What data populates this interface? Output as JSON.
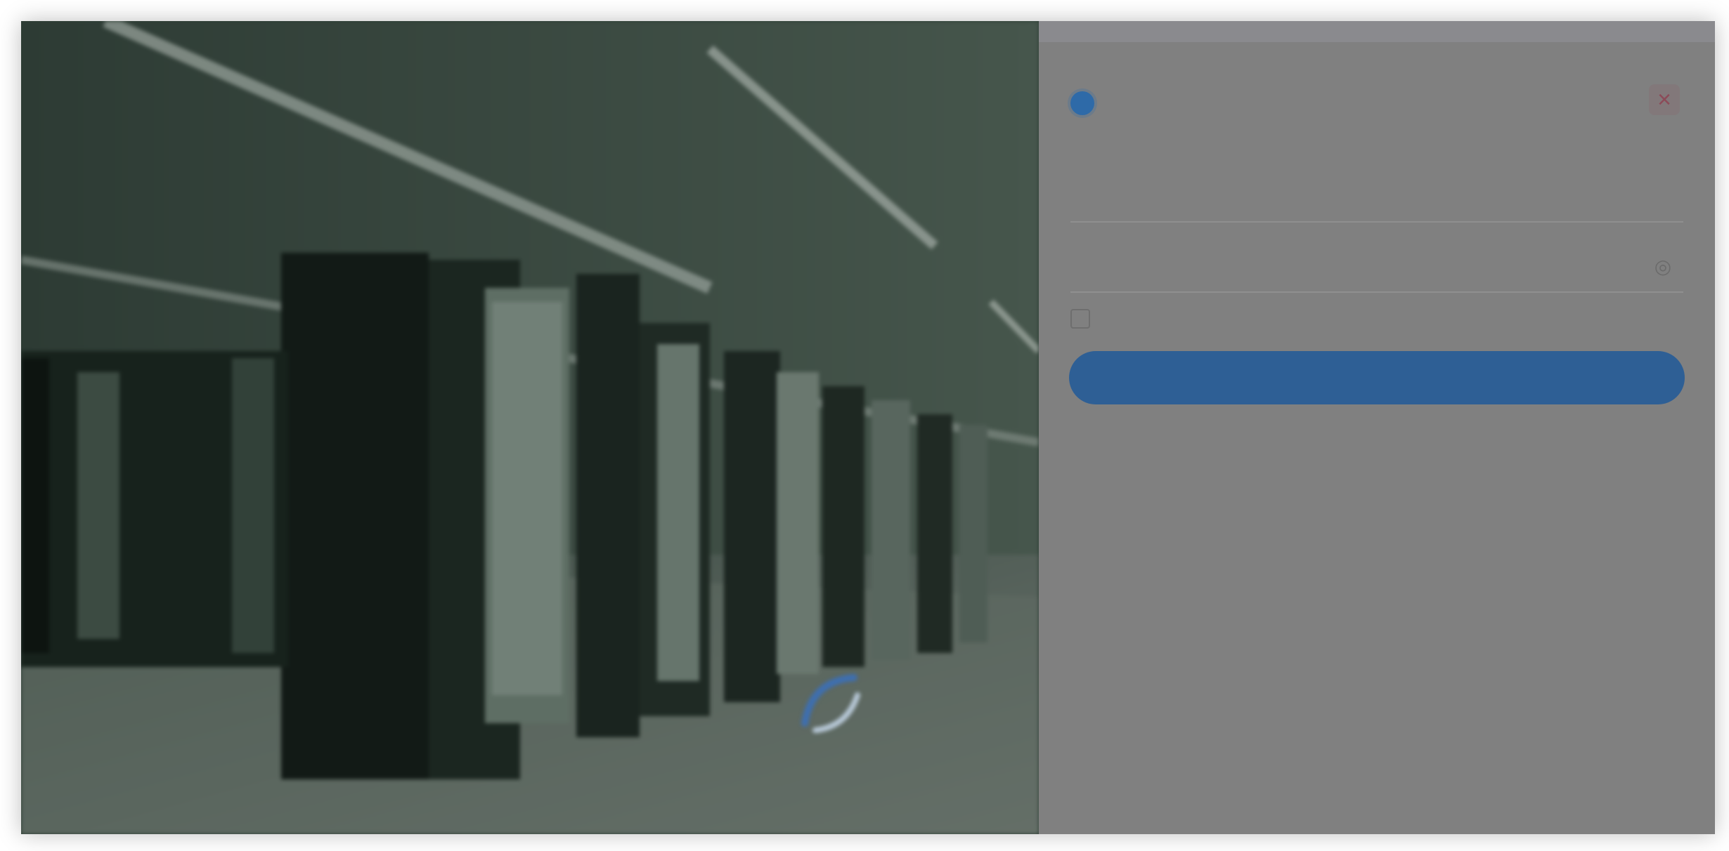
{
  "brand": {
    "name": "",
    "logo_icon": "logo-icon"
  },
  "login": {
    "username_placeholder": "",
    "password_placeholder": "",
    "remember_label": "",
    "forgot_label": "",
    "submit_label": ""
  },
  "hero": {
    "logo_caption": ""
  },
  "colors": {
    "panel_bg": "#808080",
    "accent": "#2e5f95",
    "close_accent": "#8c4a58"
  }
}
